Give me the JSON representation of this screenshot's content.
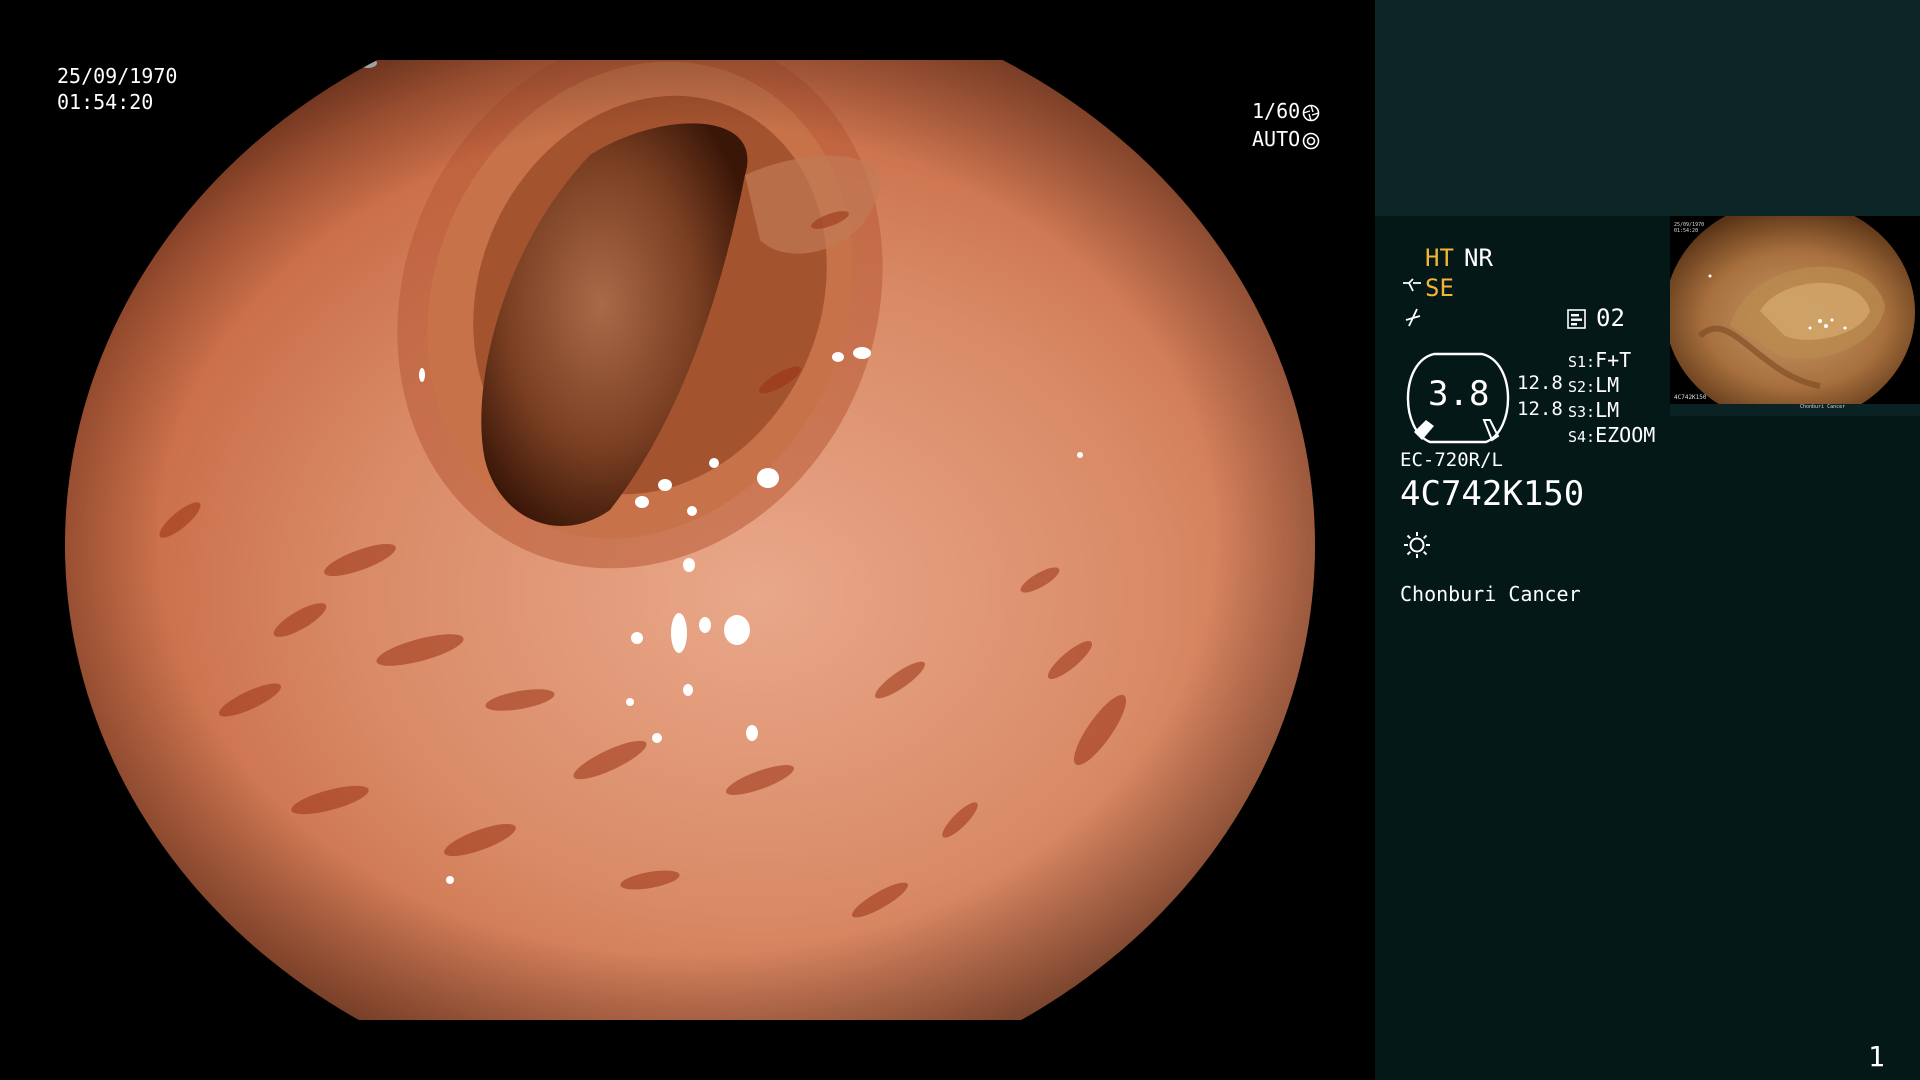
{
  "osd": {
    "date": "25/09/1970",
    "time": "01:54:20",
    "shutter": "1/60",
    "iris": "AUTO"
  },
  "panel": {
    "mode_ht": "HT",
    "mode_nr": "NR",
    "mode_se": "SE",
    "storage_count": "02",
    "gauge_value": "3.8",
    "zoom_a": "12.8",
    "zoom_b": "12.8",
    "switches": [
      {
        "key": "S1:",
        "value": "F+T"
      },
      {
        "key": "S2:",
        "value": "LM"
      },
      {
        "key": "S3:",
        "value": "LM"
      },
      {
        "key": "S4:",
        "value": "EZOOM"
      }
    ],
    "scope_model": "EC-720R/L",
    "scope_serial": "4C742K150",
    "hospital": "Chonburi Cancer",
    "page_number": "1"
  },
  "thumbnail": {
    "caption": "Chonburi Cancer",
    "serial": "4C742K150"
  },
  "colors": {
    "mucosa_light": "#e8a585",
    "mucosa_mid": "#c86a45",
    "mucosa_dark": "#7a2c14",
    "amber_text": "#f2b43a",
    "panel_bg": "#051818",
    "panel_top_bg": "#0c2527"
  },
  "icons": {
    "shutter": "aperture-icon",
    "iris": "iris-icon",
    "se": "se-mode-icon",
    "enhance": "enhance-icon",
    "storage": "storage-icon",
    "light": "light-source-icon"
  }
}
